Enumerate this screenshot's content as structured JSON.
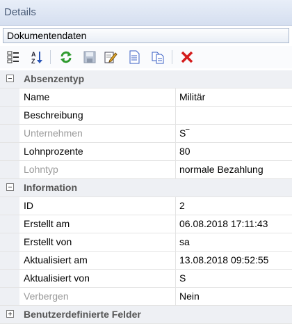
{
  "window": {
    "title": "Details"
  },
  "combo": {
    "selected": "Dokumentendaten"
  },
  "toolbar": {
    "icons": [
      "categorized-view-icon",
      "sort-alphabetical-icon",
      "refresh-icon",
      "save-icon",
      "edit-icon",
      "document-icon",
      "copy-icon",
      "delete-icon"
    ]
  },
  "categories": [
    {
      "label": "Absenzentyp",
      "expanded": true,
      "rows": [
        {
          "name": "Name",
          "value": "Militär",
          "disabled": false
        },
        {
          "name": "Beschreibung",
          "value": "",
          "disabled": false
        },
        {
          "name": "Unternehmen",
          "value": "S‾",
          "disabled": true
        },
        {
          "name": "Lohnprozente",
          "value": "80",
          "disabled": false
        },
        {
          "name": "Lohntyp",
          "value": "normale Bezahlung",
          "disabled": true
        }
      ]
    },
    {
      "label": "Information",
      "expanded": true,
      "rows": [
        {
          "name": "ID",
          "value": "2",
          "disabled": false
        },
        {
          "name": "Erstellt am",
          "value": "06.08.2018 17:11:43",
          "disabled": false
        },
        {
          "name": "Erstellt von",
          "value": "sa",
          "disabled": false
        },
        {
          "name": "Aktualisiert am",
          "value": "13.08.2018 09:52:55",
          "disabled": false
        },
        {
          "name": "Aktualisiert von",
          "value": "S",
          "disabled": false
        },
        {
          "name": "Verbergen",
          "value": "Nein",
          "disabled": true
        }
      ]
    },
    {
      "label": "Benutzerdefinierte Felder",
      "expanded": false,
      "rows": []
    }
  ]
}
